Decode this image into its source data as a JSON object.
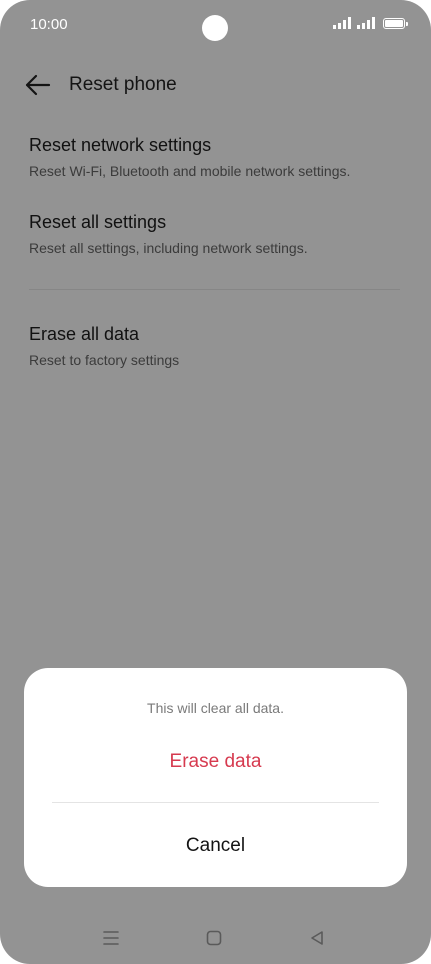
{
  "status_bar": {
    "time": "10:00"
  },
  "header": {
    "title": "Reset phone",
    "back_icon": "arrow-left-icon"
  },
  "options": [
    {
      "title": "Reset network settings",
      "subtitle": "Reset Wi-Fi, Bluetooth and mobile network settings."
    },
    {
      "title": "Reset all settings",
      "subtitle": "Reset all settings, including network settings."
    },
    {
      "title": "Erase all data",
      "subtitle": "Reset to factory settings"
    }
  ],
  "dialog": {
    "message": "This will clear all data.",
    "confirm_label": "Erase data",
    "cancel_label": "Cancel",
    "confirm_color": "#d63a4f"
  },
  "navigation": {
    "icons": [
      "menu-icon",
      "home-icon",
      "back-triangle-icon"
    ]
  },
  "colors": {
    "scrim": "#939393",
    "sheet": "#ffffff",
    "accent": "#d63a4f"
  }
}
